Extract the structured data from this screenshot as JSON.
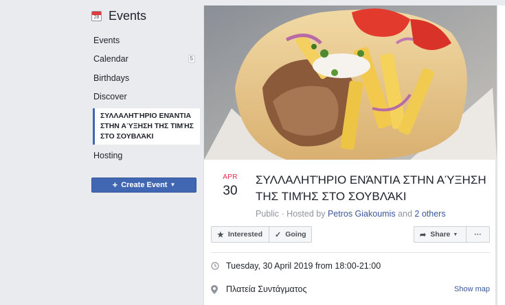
{
  "sidebar": {
    "header": {
      "title": "Events",
      "calendar_icon_number": "28"
    },
    "items": [
      {
        "label": "Events",
        "badge": ""
      },
      {
        "label": "Calendar",
        "badge": "5"
      },
      {
        "label": "Birthdays",
        "badge": ""
      },
      {
        "label": "Discover",
        "badge": ""
      }
    ],
    "selected_event": "ΣΥΛΛΑΛΗΤΉΡΙΟ ΕΝΆΝΤΙΑ ΣΤΗΝ ΑΎΞΗΣΗ ΤΗΣ ΤΙΜΉΣ ΣΤΟ ΣΟΥΒΛΆΚΙ",
    "hosting_label": "Hosting",
    "create_button_label": "Create Event"
  },
  "event": {
    "month": "APR",
    "day": "30",
    "title": "ΣΥΛΛΑΛΗΤΉΡΙΟ ΕΝΆΝΤΙΑ ΣΤΗΝ ΑΎΞΗΣΗ ΤΗΣ ΤΙΜΉΣ ΣΤΟ ΣΟΥΒΛΆΚΙ",
    "privacy": "Public",
    "hosted_by_prefix": "Hosted by",
    "host_name": "Petros Giakoumis",
    "and_text": "and",
    "others_link": "2 others",
    "datetime": "Tuesday, 30 April 2019 from 18:00-21:00",
    "location": "Πλατεία Συντάγματος",
    "show_map_label": "Show map"
  },
  "actions": {
    "interested_label": "Interested",
    "going_label": "Going",
    "share_label": "Share",
    "more_label": "···"
  },
  "colors": {
    "accent": "#4267b2",
    "link": "#385898",
    "date_month": "#f02849",
    "background": "#e9ebee"
  }
}
